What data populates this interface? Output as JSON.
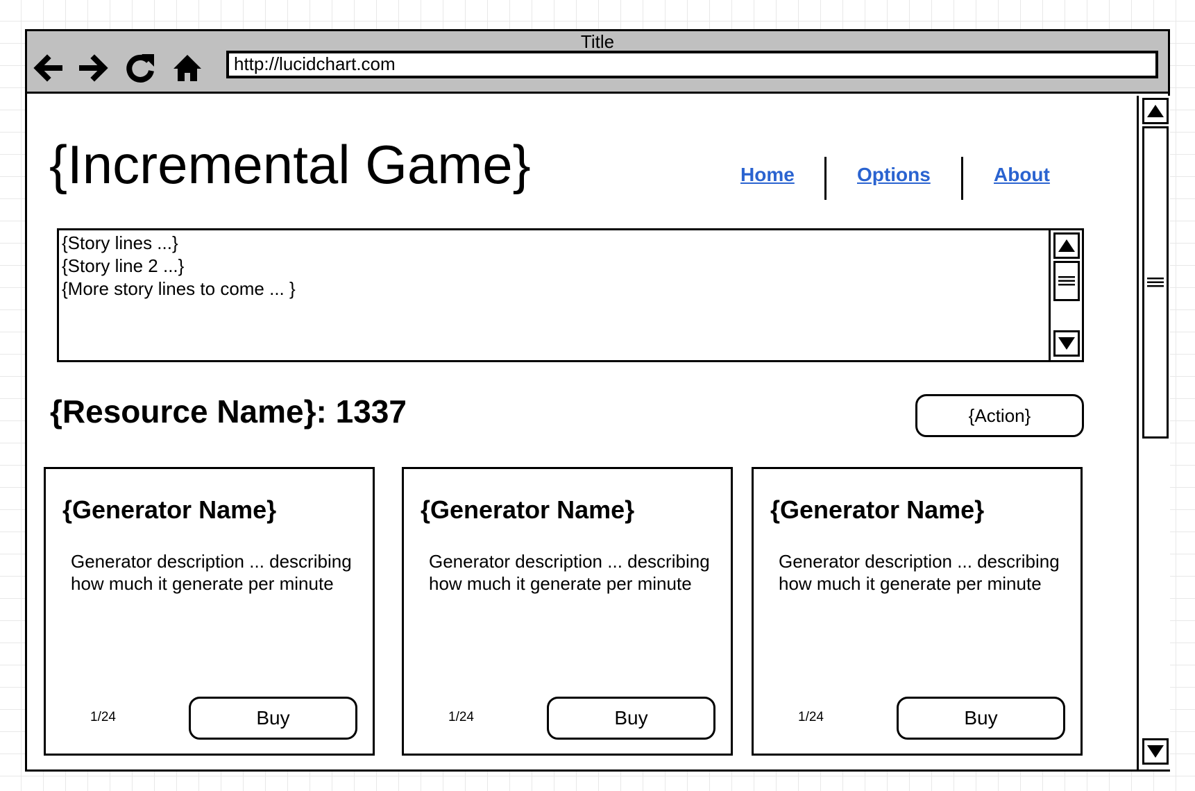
{
  "window": {
    "title": "Title"
  },
  "toolbar": {
    "url": "http://lucidchart.com",
    "back_icon": "back-arrow-icon",
    "forward_icon": "forward-arrow-icon",
    "reload_icon": "reload-icon",
    "home_icon": "home-icon"
  },
  "page": {
    "title": "{Incremental Game}",
    "nav": [
      "Home",
      "Options",
      "About"
    ],
    "link_color": "#2a63d0",
    "story": {
      "lines": [
        "{Story lines ...}",
        "{Story line 2 ...}",
        "{More story lines to come ... }"
      ]
    },
    "resource": {
      "label": "{Resource Name}: 1337"
    },
    "action_label": "{Action}",
    "generators": [
      {
        "name": "{Generator Name}",
        "description": "Generator description ... describing how much it generate per minute",
        "count": "1/24",
        "buy_label": "Buy"
      },
      {
        "name": "{Generator Name}",
        "description": "Generator description ... describing how much it generate per minute",
        "count": "1/24",
        "buy_label": "Buy"
      },
      {
        "name": "{Generator Name}",
        "description": "Generator description ... describing how much it generate per minute",
        "count": "1/24",
        "buy_label": "Buy"
      }
    ]
  }
}
